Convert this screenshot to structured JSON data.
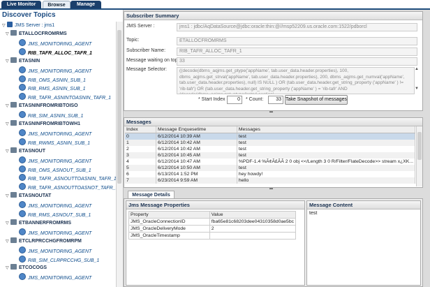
{
  "tabs": {
    "live": "Live Monitor",
    "browse": "Browse",
    "manage": "Manage"
  },
  "left": {
    "title": "Discover Topics",
    "server": "JMS Server : jms1",
    "tree": [
      {
        "type": "topic",
        "label": "ETALLOCFROMRMS"
      },
      {
        "type": "agent",
        "label": "JMS_MONITORING_AGENT"
      },
      {
        "type": "sel",
        "label": "RIB_TAFR_ALLOC_TAFR_1"
      },
      {
        "type": "topic",
        "label": "ETASNIN"
      },
      {
        "type": "agent",
        "label": "JMS_MONITORING_AGENT"
      },
      {
        "type": "agent",
        "label": "RIB_OMS_ASNIN_SUB_1"
      },
      {
        "type": "agent",
        "label": "RIB_RMS_ASNIN_SUB_1"
      },
      {
        "type": "agent",
        "label": "RIB_TAFR_ASNINTOASNIN_TAFR_1"
      },
      {
        "type": "topic",
        "label": "ETASNINFROMRIBTOISO"
      },
      {
        "type": "agent",
        "label": "RIB_SIM_ASNIN_SUB_1"
      },
      {
        "type": "topic",
        "label": "ETASNINFROMRIBTOWH1"
      },
      {
        "type": "agent",
        "label": "JMS_MONITORING_AGENT"
      },
      {
        "type": "agent",
        "label": "RIB_RWMS_ASNIN_SUB_1"
      },
      {
        "type": "topic",
        "label": "ETASNOUT"
      },
      {
        "type": "agent",
        "label": "JMS_MONITORING_AGENT"
      },
      {
        "type": "agent",
        "label": "RIB_OMS_ASNOUT_SUB_1"
      },
      {
        "type": "agent",
        "label": "RIB_TAFR_ASNOUTTOASNIN_TAFR_1"
      },
      {
        "type": "agent",
        "label": "RIB_TAFR_ASNOUTTOASNOT_TAFR_1"
      },
      {
        "type": "topic",
        "label": "ETASNOUTAT"
      },
      {
        "type": "agent",
        "label": "JMS_MONITORING_AGENT"
      },
      {
        "type": "agent",
        "label": "RIB_RMS_ASNOUT_SUB_1"
      },
      {
        "type": "topic",
        "label": "ETBANNERFROMRMS"
      },
      {
        "type": "agent",
        "label": "JMS_MONITORING_AGENT"
      },
      {
        "type": "topic",
        "label": "ETCLRPRCCHGFROMRPM"
      },
      {
        "type": "agent",
        "label": "JMS_MONITORING_AGENT"
      },
      {
        "type": "agent",
        "label": "RIB_SIM_CLRPRCCHG_SUB_1"
      },
      {
        "type": "topic",
        "label": "ETCOCOGS"
      },
      {
        "type": "agent",
        "label": "JMS_MONITORING_AGENT"
      }
    ]
  },
  "summary": {
    "title": "Subscriber Summary",
    "server_label": "JMS Server :",
    "server_value": "jms1 : jdbc/AqDataSource@jdbc:oracle:thin:@//msp52209.us.oracle.com:1522/pdborcl",
    "topic_label": "Topic:",
    "topic_value": "ETALLOCFROMRMS",
    "subscriber_label": "Subscriber Name:",
    "subscriber_value": "RIB_TAFR_ALLOC_TAFR_1",
    "waiting_label": "Message waiting on topic:",
    "waiting_value": "33",
    "selector_label": "Message Selector:",
    "selector_value": "((decode(dbms_aqjms.get_ptype('appName', tab.user_data.header.properties), 100, dbms_aqjms.get_strval('appName', tab.user_data.header.properties), 200, dbms_aqjms.get_numval('appName', tab.user_data.header.properties), null) IS NULL ) OR (tab.user_data.header.get_string_property ('appName' ) != 'rib-tafr') OR (tab.user_data.header.get_string_property ('appName' ) = 'rib-tafr' AND (decode(dbms_aqjms.get_ptype('retryLocation',",
    "start_label": "* Start Index :",
    "start_value": "0",
    "count_label": "* Count:",
    "count_value": "33",
    "snapshot_label": "Take Snapshot of messages"
  },
  "messages": {
    "title": "Messages",
    "columns": [
      "Index",
      "Message Enquesetime",
      "Messages"
    ],
    "rows": [
      [
        "0",
        "6/12/2014 10:39 AM",
        "test"
      ],
      [
        "1",
        "6/12/2014 10:42 AM",
        "test"
      ],
      [
        "2",
        "6/12/2014 10:42 AM",
        "test"
      ],
      [
        "3",
        "6/12/2014 10:45 AM",
        "test"
      ],
      [
        "4",
        "6/12/2014 10:47 AM",
        "%PDF-1.4 %Ã¢Ã£ÃÃ 2 0 obj <</Length 3 0 R/Filter/FlateDecode>> stream x¿XK..."
      ],
      [
        "5",
        "6/12/2014 10:50 AM",
        "test"
      ],
      [
        "6",
        "6/13/2014 1:52 PM",
        "hey howdy!"
      ],
      [
        "7",
        "6/23/2014 9:59 AM",
        "hello"
      ]
    ]
  },
  "details": {
    "tab": "Message Details",
    "props_title": "Jms Message Properties",
    "columns": [
      "Property",
      "Value"
    ],
    "rows": [
      [
        "JMS_OracleConnectionID",
        "fba65e81c68203dee04310358d0ae5bc"
      ],
      [
        "JMS_OracleDeliveryMode",
        "2"
      ],
      [
        "JMS_OracleTimestamp",
        ""
      ]
    ],
    "content_title": "Message Content",
    "content_value": "test"
  }
}
